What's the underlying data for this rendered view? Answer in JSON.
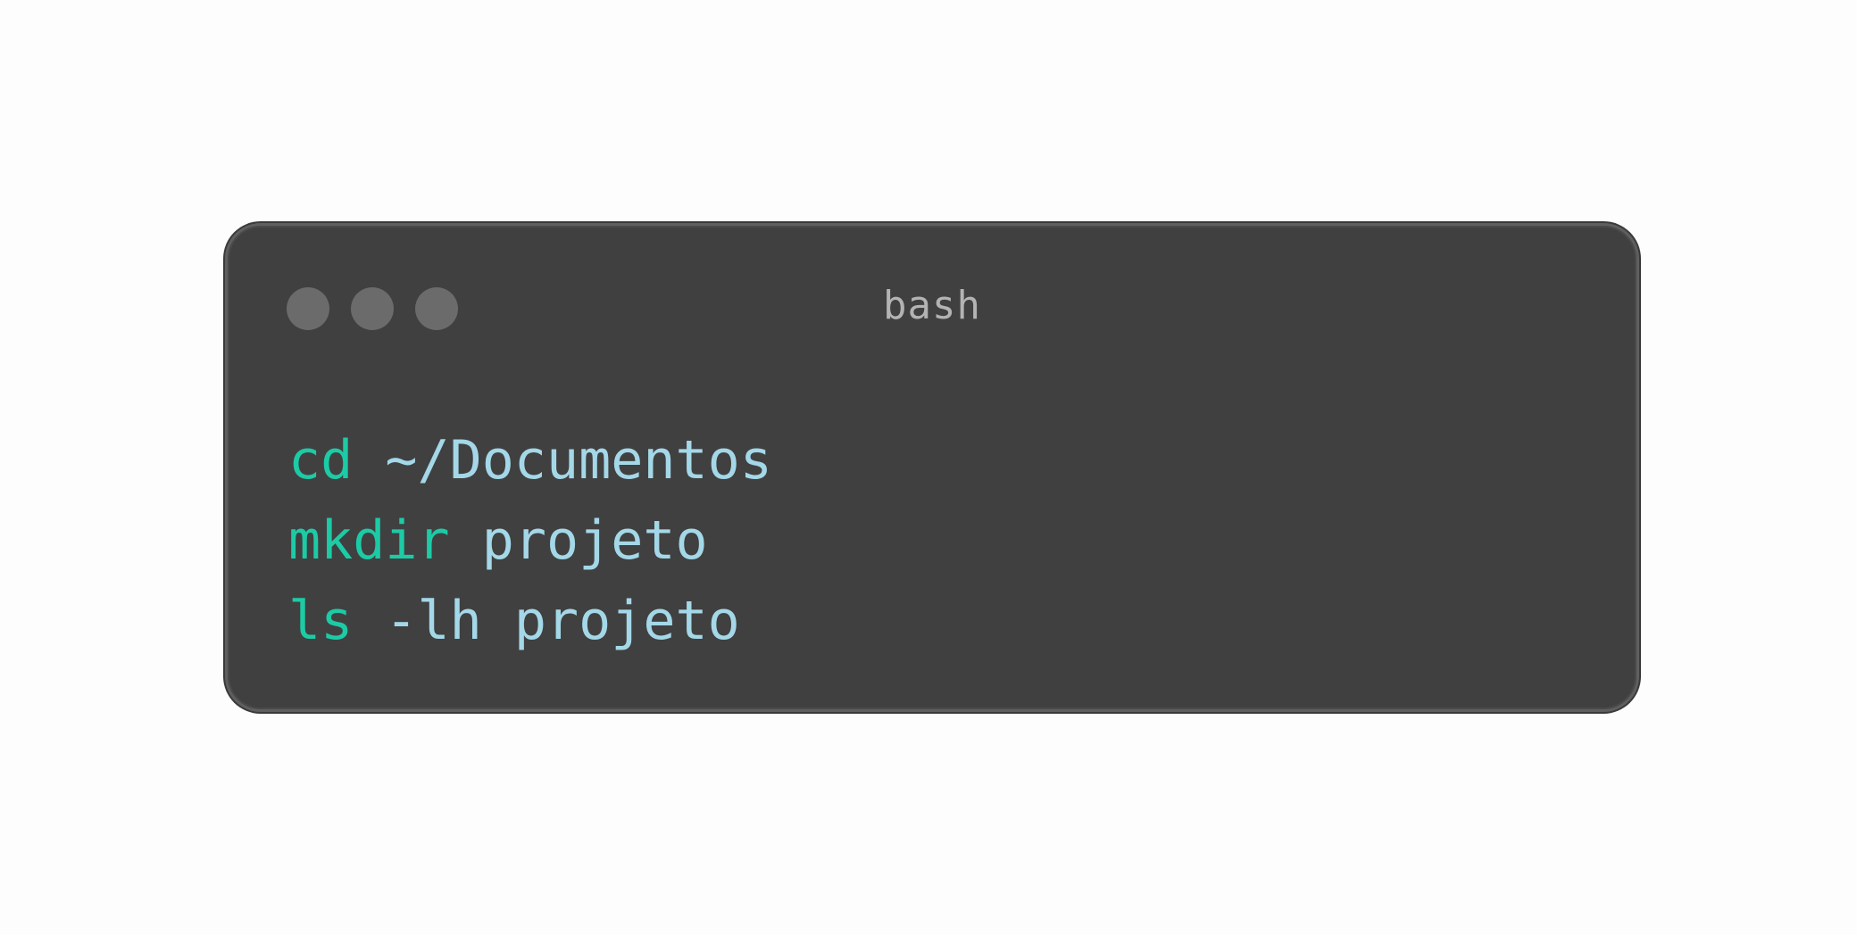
{
  "window": {
    "title": "bash",
    "traffic_lights": [
      {
        "name": "close",
        "color": "#6b6b6b"
      },
      {
        "name": "minimize",
        "color": "#6b6b6b"
      },
      {
        "name": "maximize",
        "color": "#6b6b6b"
      }
    ]
  },
  "colors": {
    "background": "#fdfdfd",
    "window_bg": "#404040",
    "title_text": "#b3b3b3",
    "command": "#1ccba6",
    "argument": "#a4d8e8"
  },
  "terminal": {
    "lines": [
      {
        "command": "cd",
        "args": "~/Documentos"
      },
      {
        "command": "mkdir",
        "args": "projeto"
      },
      {
        "command": "ls",
        "args": "-lh projeto"
      }
    ]
  }
}
